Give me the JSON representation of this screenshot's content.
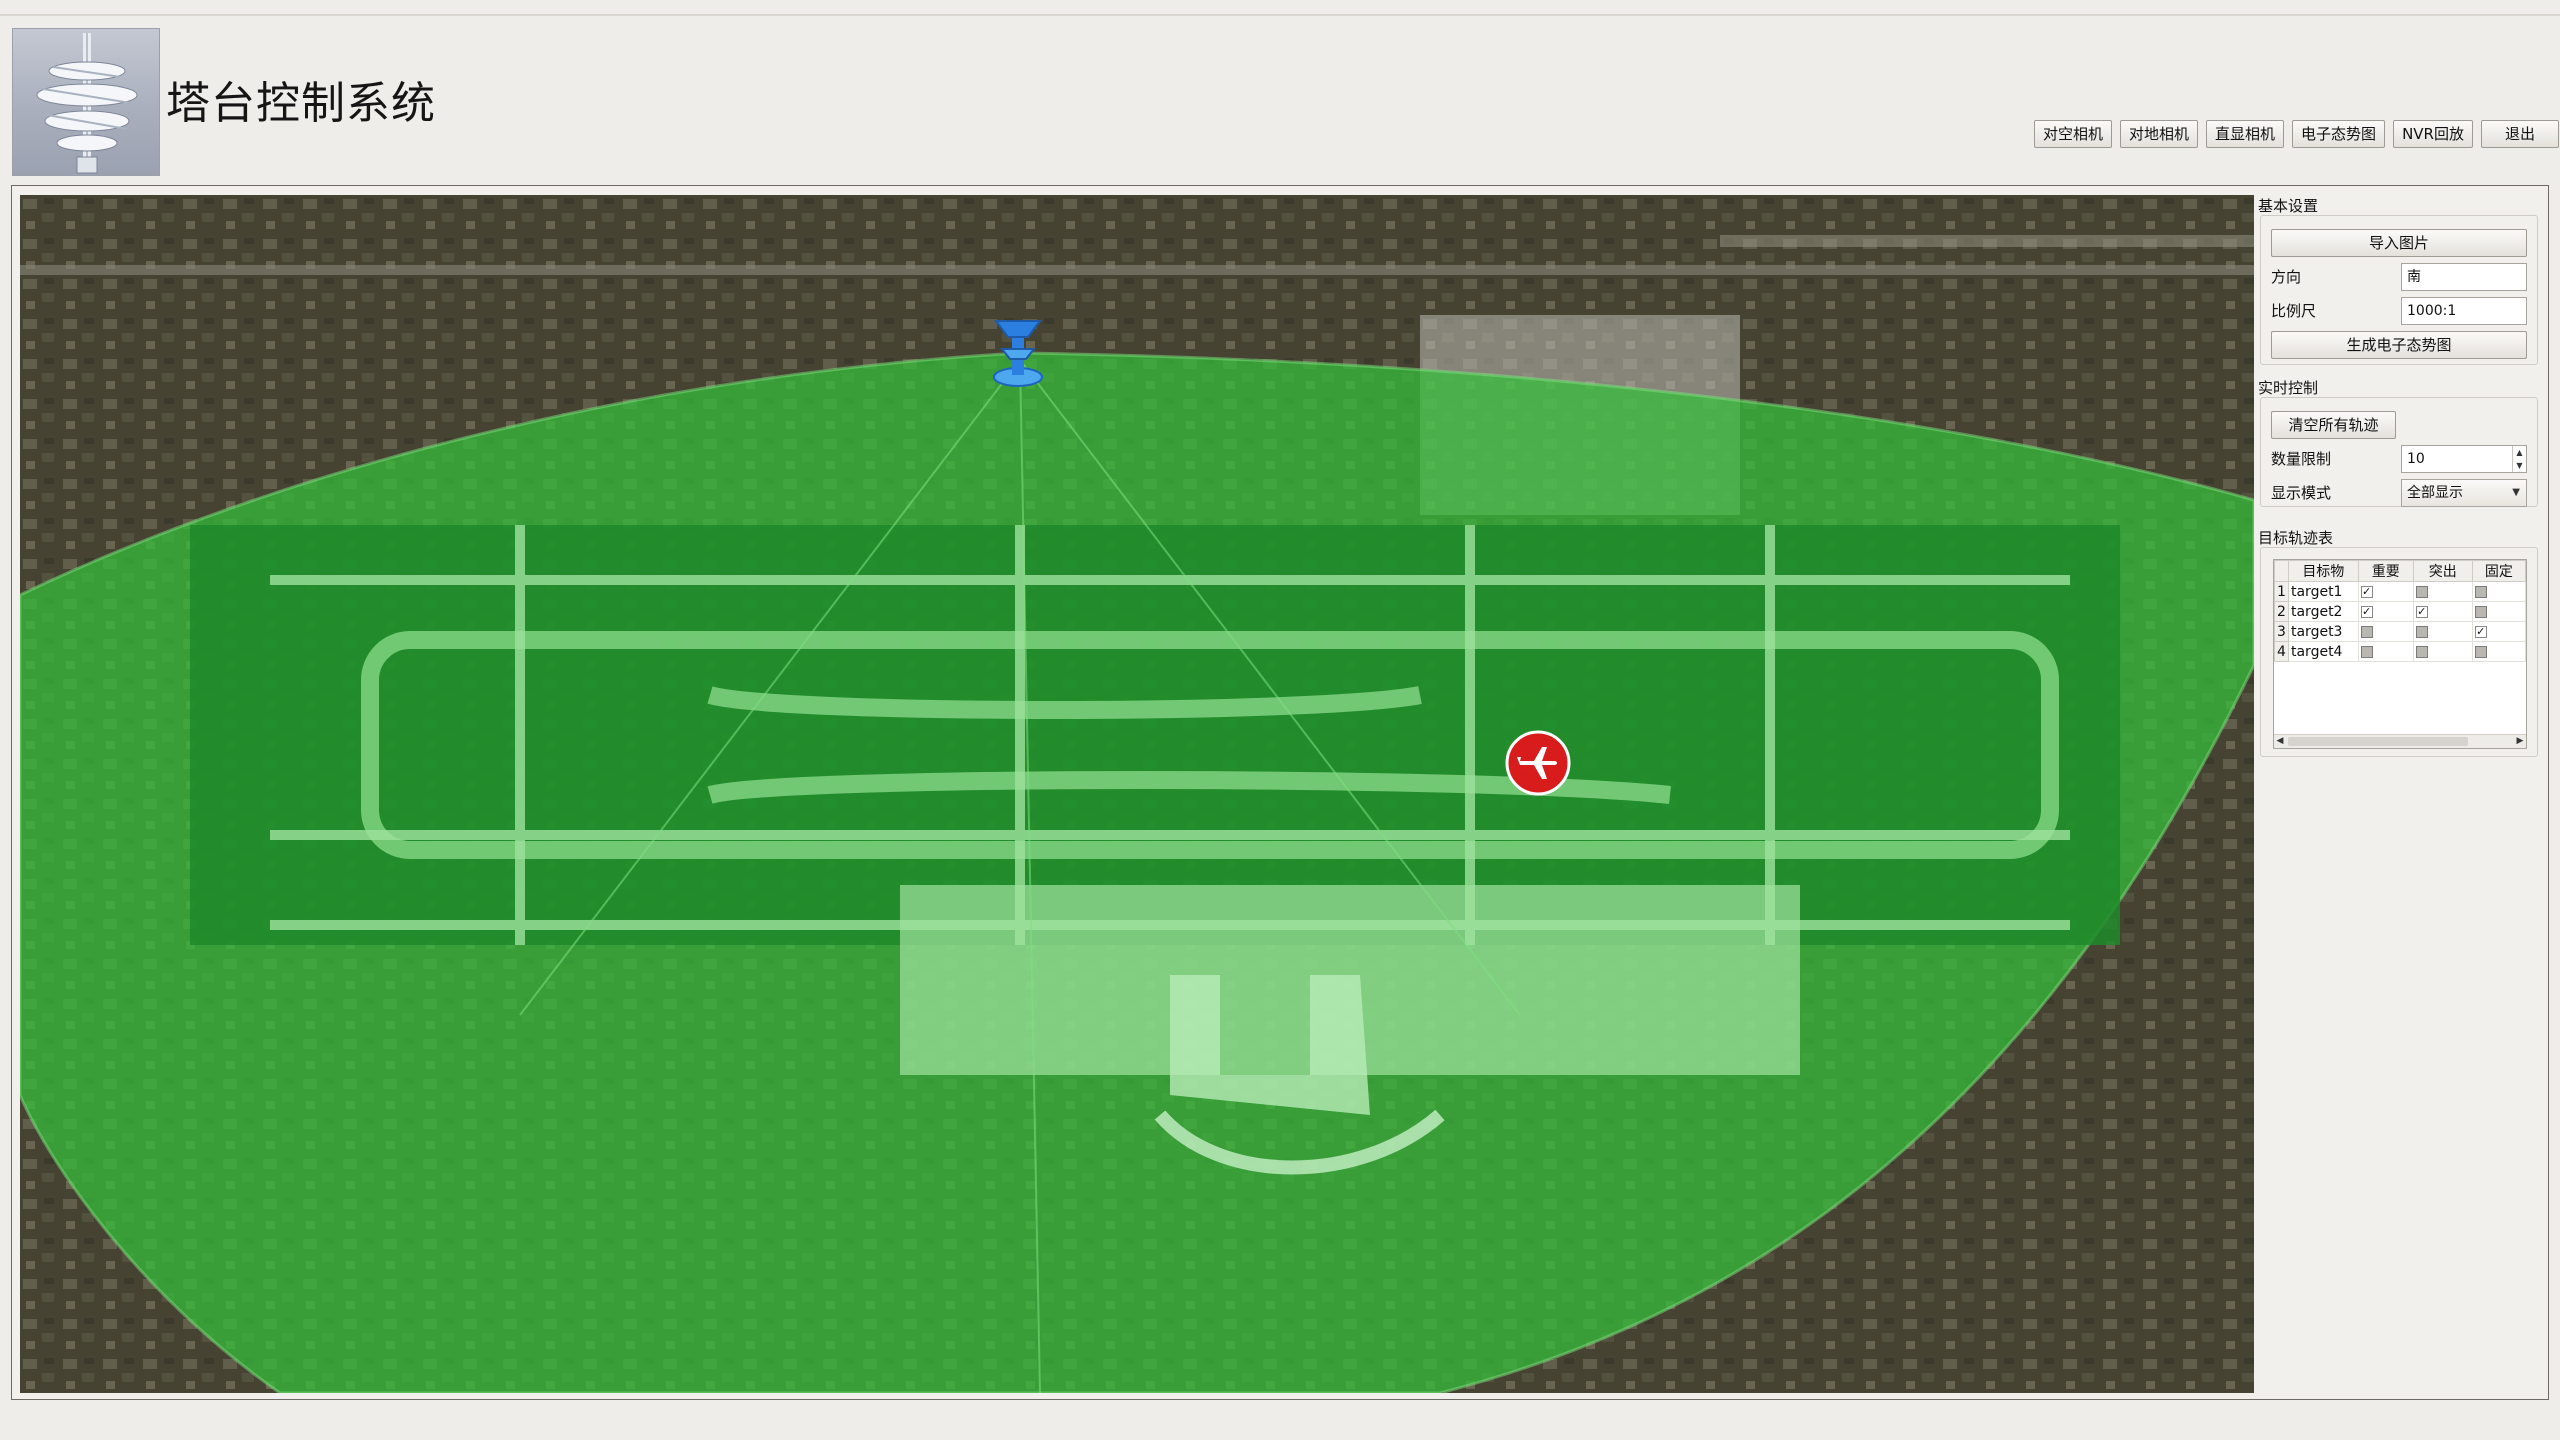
{
  "app": {
    "title": "塔台控制系统"
  },
  "toolbar": {
    "buttons": [
      {
        "label": "对空相机"
      },
      {
        "label": "对地相机"
      },
      {
        "label": "直显相机"
      },
      {
        "label": "电子态势图"
      },
      {
        "label": "NVR回放"
      },
      {
        "label": "退出"
      }
    ]
  },
  "basic_settings": {
    "label": "基本设置",
    "import_button": "导入图片",
    "direction_label": "方向",
    "direction_value": "南",
    "scale_label": "比例尺",
    "scale_value": "1000:1",
    "generate_button": "生成电子态势图"
  },
  "realtime": {
    "label": "实时控制",
    "clear_button": "清空所有轨迹",
    "limit_label": "数量限制",
    "limit_value": "10",
    "mode_label": "显示模式",
    "mode_value": "全部显示"
  },
  "tracks": {
    "label": "目标轨迹表",
    "headers": [
      "目标物",
      "重要",
      "突出",
      "固定"
    ],
    "rows": [
      {
        "num": "1",
        "name": "target1",
        "important": true,
        "highlight": false,
        "fixed": false
      },
      {
        "num": "2",
        "name": "target2",
        "important": true,
        "highlight": true,
        "fixed": false
      },
      {
        "num": "3",
        "name": "target3",
        "important": false,
        "highlight": false,
        "fixed": true
      },
      {
        "num": "4",
        "name": "target4",
        "important": false,
        "highlight": false,
        "fixed": false
      }
    ]
  },
  "map": {
    "icons": [
      "radar-tower-icon",
      "airplane-icon"
    ],
    "coverage_color": "#2fbf2f",
    "marker_color": "#d81c1c",
    "tower_color": "#2a7fe0"
  }
}
